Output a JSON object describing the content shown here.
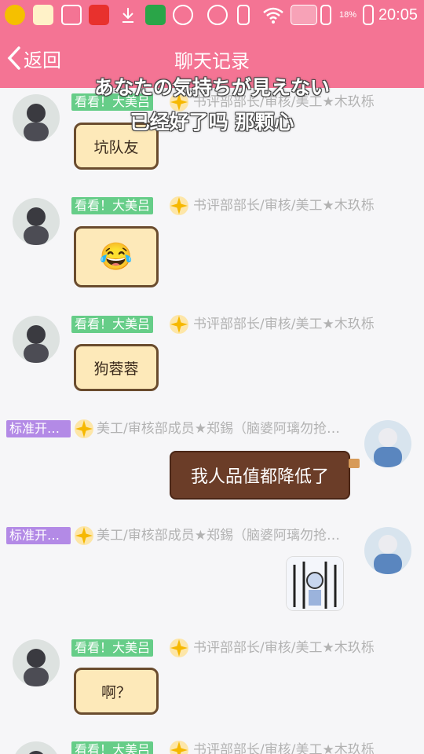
{
  "status_bar": {
    "time": "20:05",
    "battery_pct": "18%"
  },
  "header": {
    "back_label": "返回",
    "title": "聊天记录"
  },
  "lyrics": {
    "line1": "あなたの気持ちが見えない",
    "line2": "已经好了吗 那颗心"
  },
  "users": {
    "a": {
      "badge": "看看！大美吕",
      "name": "书评部部长/审核/美工★木玖栎"
    },
    "b": {
      "badge": "标准开…",
      "name": "美工/审核部成员★郑錫（脑婆阿璃勿抢…"
    }
  },
  "messages": [
    {
      "user": "a",
      "sticker_text": "坑队友"
    },
    {
      "user": "a",
      "sticker_emoji": "😂"
    },
    {
      "user": "a",
      "sticker_text": "狗蓉蓉"
    },
    {
      "user": "b",
      "text": "我人品值都降低了"
    },
    {
      "user": "b",
      "image": "meme-image"
    },
    {
      "user": "a",
      "sticker_text": "啊？"
    },
    {
      "user": "a"
    }
  ],
  "colors": {
    "accent": "#f47494",
    "badge_green": "#66cd88",
    "badge_purple": "#b38ae6"
  }
}
